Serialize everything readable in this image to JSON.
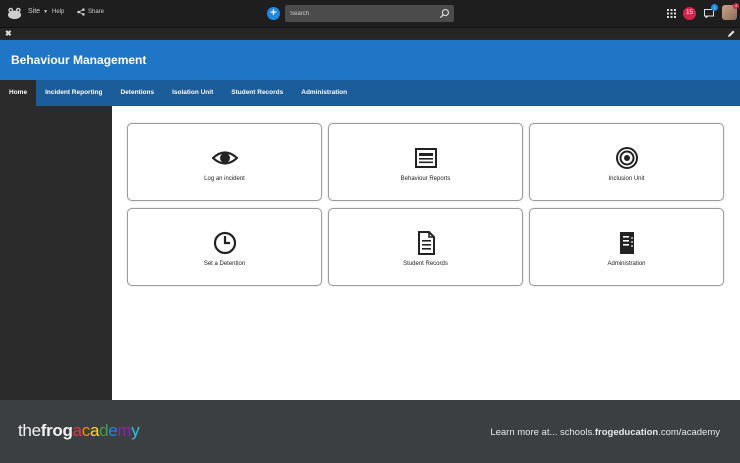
{
  "topbar": {
    "site_label": "Site",
    "help_label": "Help",
    "share_label": "Share",
    "search_placeholder": "Search",
    "notification_count": "15",
    "message_count": "1",
    "avatar_badge": "4"
  },
  "header": {
    "title": "Behaviour Management",
    "accent_color": "#1f76c6"
  },
  "nav": {
    "items": [
      {
        "label": "Home",
        "active": true
      },
      {
        "label": "Incident Reporting"
      },
      {
        "label": "Detentions"
      },
      {
        "label": "Isolation Unit"
      },
      {
        "label": "Student Records"
      },
      {
        "label": "Administration"
      }
    ]
  },
  "cards": [
    {
      "label": "Log an incident",
      "icon": "eye-icon"
    },
    {
      "label": "Behaviour Reports",
      "icon": "newspaper-icon"
    },
    {
      "label": "Inclusion Unit",
      "icon": "target-icon"
    },
    {
      "label": "Set a Detention",
      "icon": "clock-icon"
    },
    {
      "label": "Student Records",
      "icon": "document-icon"
    },
    {
      "label": "Administration",
      "icon": "admin-file-icon"
    }
  ],
  "footer": {
    "brand_the": "the",
    "brand_frog": "frog",
    "brand_academy": [
      "a",
      "c",
      "a",
      "d",
      "e",
      "m",
      "y"
    ],
    "learn_prefix": "Learn more at... schools.",
    "learn_bold": "frogeducation",
    "learn_suffix": ".com/academy"
  }
}
